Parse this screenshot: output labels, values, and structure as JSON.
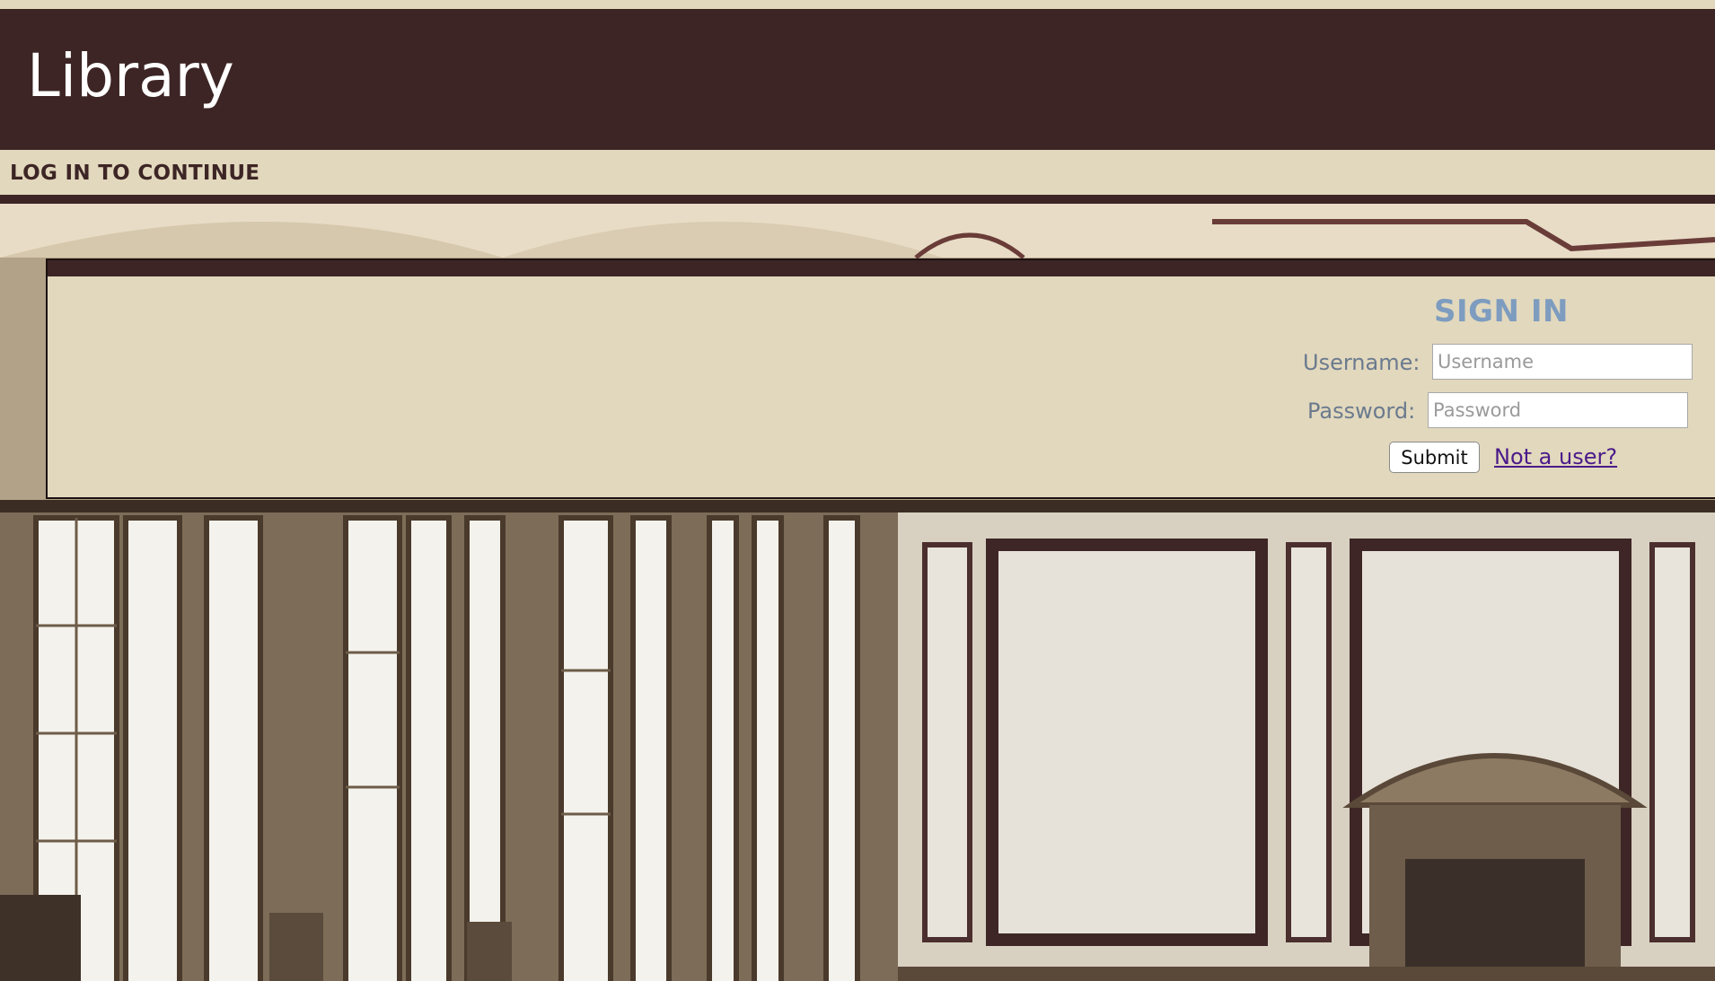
{
  "header": {
    "title": "Library"
  },
  "subheader": {
    "text": "LOG IN TO CONTINUE"
  },
  "signin": {
    "heading": "SIGN IN",
    "username_label": "Username:",
    "username_placeholder": "Username",
    "username_value": "",
    "password_label": "Password:",
    "password_placeholder": "Password",
    "password_value": "",
    "submit_label": "Submit",
    "not_user_link": "Not a user?"
  },
  "colors": {
    "header_bg": "#3d2525",
    "page_bg": "#e2d8bd",
    "heading": "#7d9cbf",
    "label": "#6a7a8e",
    "link": "#4a1a8a"
  }
}
